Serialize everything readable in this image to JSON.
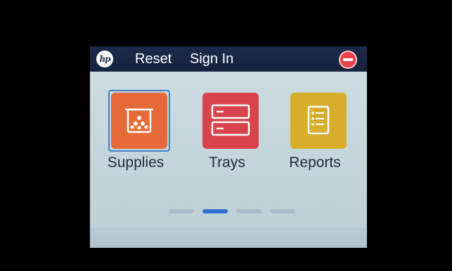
{
  "topbar": {
    "logo_text": "hp",
    "reset_label": "Reset",
    "signin_label": "Sign In",
    "stop_icon": "stop-icon"
  },
  "tiles": [
    {
      "label": "Supplies",
      "icon": "supplies-icon",
      "color": "#e66a37",
      "selected": true
    },
    {
      "label": "Trays",
      "icon": "trays-icon",
      "color": "#d9434b",
      "selected": false
    },
    {
      "label": "Reports",
      "icon": "reports-icon",
      "color": "#d7ad2b",
      "selected": false
    }
  ],
  "pager": {
    "pages": 4,
    "current_page": 2,
    "active_color": "#2f6fd0"
  },
  "colors": {
    "topbar": "#15233f",
    "screen_bg": "#c6d7dc",
    "accent": "#3f7ec9"
  }
}
